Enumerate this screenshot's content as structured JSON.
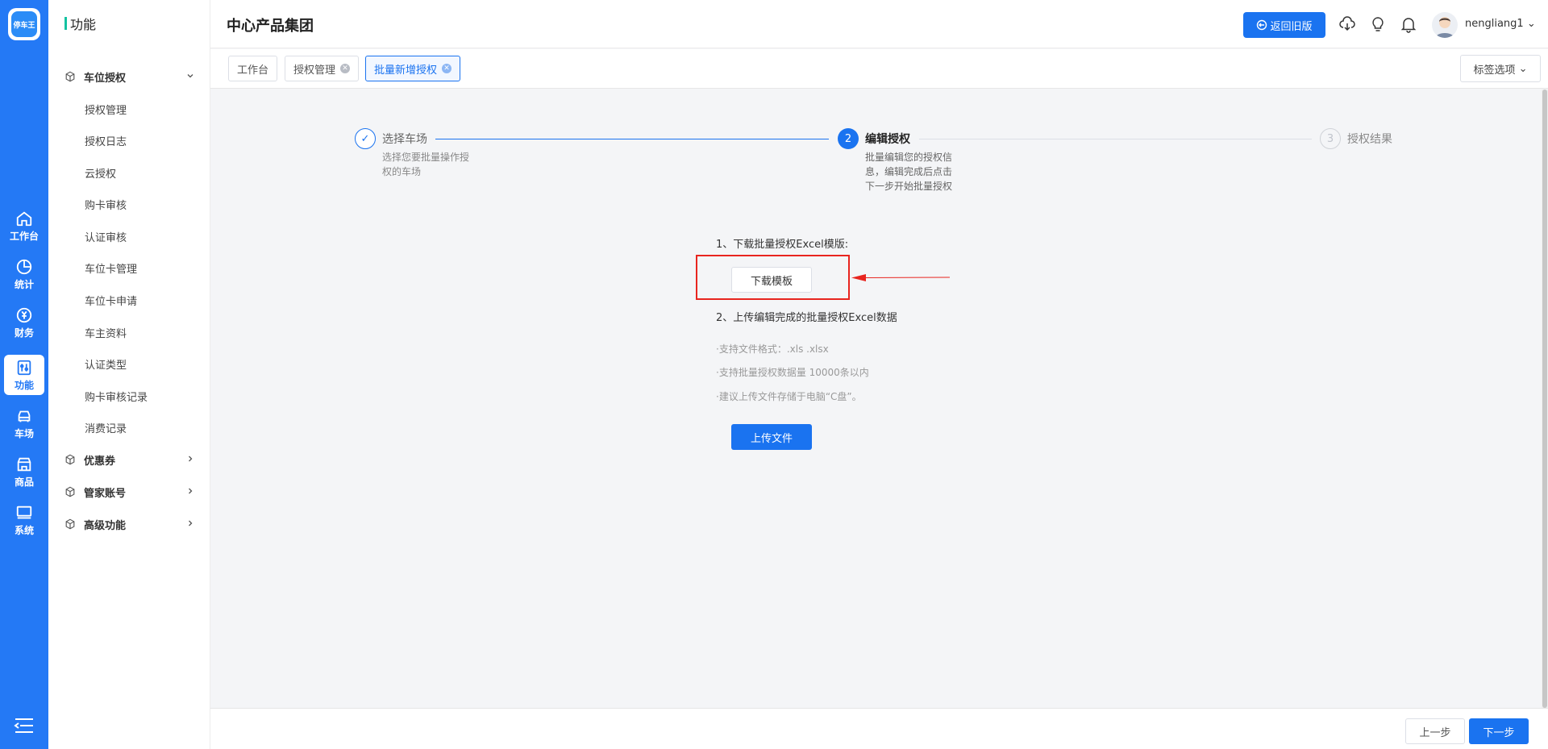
{
  "brand": {
    "logo_text": "停车王"
  },
  "rail": {
    "items": [
      {
        "label": "工作台",
        "icon": "home-icon"
      },
      {
        "label": "统计",
        "icon": "pie-chart-icon"
      },
      {
        "label": "财务",
        "icon": "yen-icon"
      },
      {
        "label": "功能",
        "icon": "sliders-icon",
        "active": true
      },
      {
        "label": "车场",
        "icon": "car-icon"
      },
      {
        "label": "商品",
        "icon": "store-icon"
      },
      {
        "label": "系统",
        "icon": "monitor-icon"
      }
    ],
    "menu_icon": "menu-icon"
  },
  "sidebar": {
    "title": "功能",
    "groups": [
      {
        "label": "车位授权",
        "expanded": true
      },
      {
        "label": "优惠券"
      },
      {
        "label": "管家账号"
      },
      {
        "label": "高级功能"
      }
    ],
    "sub_items": [
      "授权管理",
      "授权日志",
      "云授权",
      "购卡审核",
      "认证审核",
      "车位卡管理",
      "车位卡申请",
      "车主资料",
      "认证类型",
      "购卡审核记录",
      "消费记录"
    ]
  },
  "header": {
    "title": "中心产品集团",
    "old_version_button": "返回旧版",
    "username": "nengliang1"
  },
  "tabs": {
    "items": [
      {
        "label": "工作台",
        "closable": false
      },
      {
        "label": "授权管理",
        "closable": true
      },
      {
        "label": "批量新增授权",
        "closable": true,
        "active": true
      }
    ],
    "options_label": "标签选项"
  },
  "steps": [
    {
      "index": "1",
      "title": "选择车场",
      "desc_lines": [
        "选择您要批量操作授",
        "权的车场"
      ],
      "status": "done"
    },
    {
      "index": "2",
      "title": "编辑授权",
      "desc_lines": [
        "批量编辑您的授权信",
        "息，编辑完成后点击",
        "下一步开始批量授权"
      ],
      "status": "active"
    },
    {
      "index": "3",
      "title": "授权结果",
      "desc_lines": [],
      "status": "wait"
    }
  ],
  "main": {
    "step1_label": "1、下载批量授权Excel模版:",
    "download_button": "下载模板",
    "step2_label": "2、上传编辑完成的批量授权Excel数据",
    "hints": [
      "·支持文件格式：.xls .xlsx",
      "·支持批量授权数据量 10000条以内",
      "·建议上传文件存储于电脑“C盘”。"
    ],
    "upload_button": "上传文件"
  },
  "footer": {
    "prev_button": "上一步",
    "next_button": "下一步"
  },
  "colors": {
    "primary": "#1a73f0",
    "rail": "#2479f5",
    "annotation_red": "#e8251f"
  }
}
